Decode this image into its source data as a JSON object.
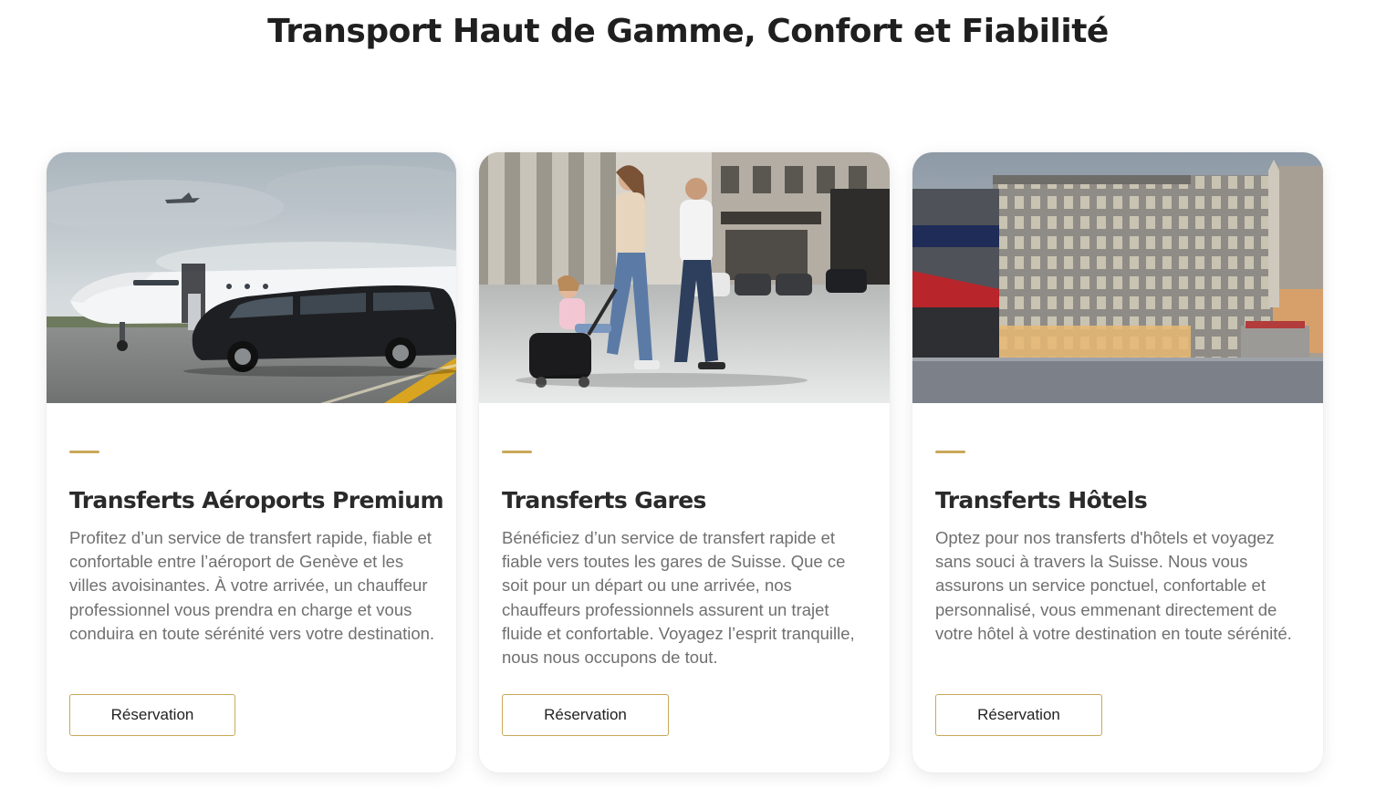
{
  "theme": {
    "accent": "#c9a85a",
    "heading_color": "#1f1f1f",
    "text_color": "#707070"
  },
  "section": {
    "title": "Transport Haut de Gamme, Confort et Fiabilité"
  },
  "cards": [
    {
      "image": "airport-van-private-jet-photo",
      "title": "Transferts Aéroports Premium",
      "text": "Profitez d’un service de transfert rapide, fiable et confortable entre l’aéroport de Genève et les villes avoisinantes. À votre arrivée, un chauffeur professionnel vous prendra en charge et vous conduira en toute sérénité vers votre destination.",
      "button_label": "Réservation"
    },
    {
      "image": "family-walking-with-luggage-photo",
      "title": "Transferts Gares",
      "text": "Bénéficiez d’un service de transfert rapide et fiable vers toutes les gares de Suisse. Que ce soit pour un départ ou une arrivée, nos chauffeurs professionnels assurent un trajet fluide et confortable. Voyagez l’esprit tranquille, nous nous occupons de tout.",
      "button_label": "Réservation"
    },
    {
      "image": "hotel-building-city-square-photo",
      "title": "Transferts Hôtels",
      "text": "Optez pour nos transferts d'hôtels et voyagez sans souci à travers la Suisse. Nous vous assurons un service ponctuel, confortable et personnalisé, vous emmenant directement de votre hôtel à votre destination en toute sérénité.",
      "button_label": "Réservation"
    }
  ]
}
